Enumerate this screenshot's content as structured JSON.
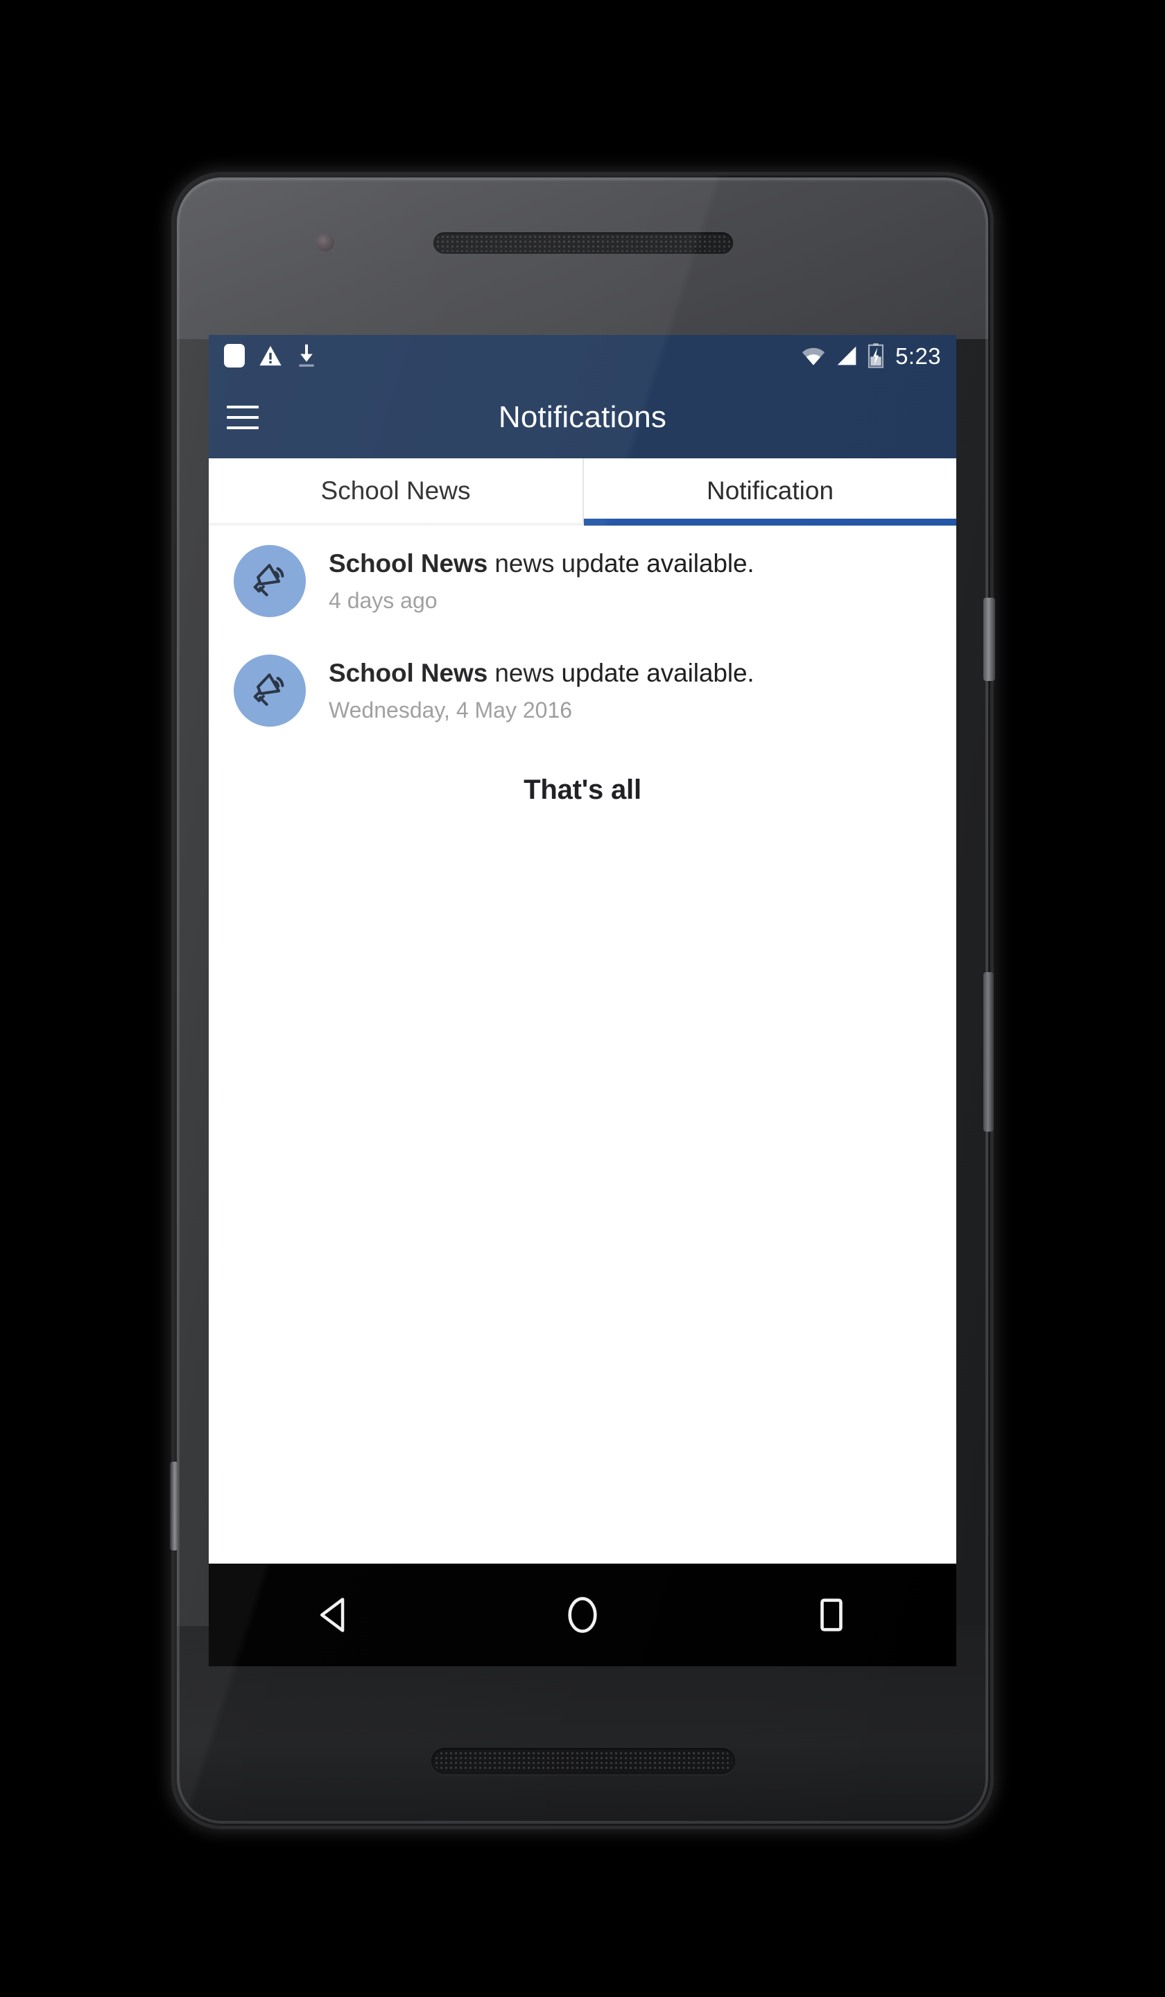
{
  "device": {
    "frame": "android-phone",
    "hardware": {
      "front_camera": "camera-icon",
      "earpiece": "earpiece-speaker",
      "bottom_speaker": "bottom-speaker",
      "power_button": "power-button",
      "volume_button": "volume-rocker",
      "left_button": "left-side-button"
    }
  },
  "statusbar": {
    "time": "5:23",
    "left_icons": [
      "blank-notification-icon",
      "warning-triangle-icon",
      "download-icon"
    ],
    "right_icons": [
      "wifi-icon",
      "cell-signal-icon",
      "battery-charging-icon"
    ],
    "background": "#22395c"
  },
  "appbar": {
    "menu_icon": "hamburger-menu-icon",
    "title": "Notifications",
    "background": "#22395c",
    "text_color": "#ffffff"
  },
  "tabs": {
    "items": [
      {
        "label": "School News",
        "active": false
      },
      {
        "label": "Notification",
        "active": true
      }
    ],
    "indicator_color": "#2356a6"
  },
  "list": {
    "items": [
      {
        "icon": "megaphone-icon",
        "avatar_color": "#7fa5d8",
        "title_bold": "School News",
        "title_rest": " news update available.",
        "subtitle": "4 days ago"
      },
      {
        "icon": "megaphone-icon",
        "avatar_color": "#7fa5d8",
        "title_bold": "School News",
        "title_rest": " news update available.",
        "subtitle": "Wednesday, 4 May 2016"
      }
    ],
    "end_label": "That's all"
  },
  "navbar": {
    "back": "back-triangle-icon",
    "home": "home-circle-icon",
    "recents": "recents-square-icon",
    "background": "#000000"
  }
}
